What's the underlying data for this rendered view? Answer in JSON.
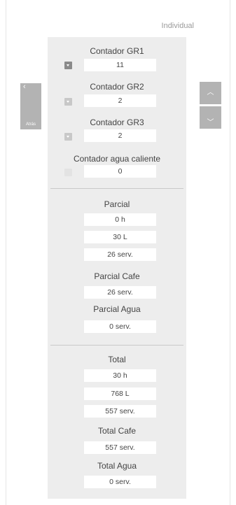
{
  "header": {
    "mode": "Individual"
  },
  "nav": {
    "back_label": "Atrás",
    "back_chevron": "‹",
    "up_chevron": "︿",
    "down_chevron": "﹀"
  },
  "counters": [
    {
      "title": "Contador GR1",
      "value": "11"
    },
    {
      "title": "Contador GR2",
      "value": "2"
    },
    {
      "title": "Contador GR3",
      "value": "2"
    },
    {
      "title": "Contador agua caliente",
      "value": "0"
    }
  ],
  "partial": {
    "title": "Parcial",
    "values": [
      "0 h",
      "30 L",
      "26 serv."
    ],
    "cafe_title": "Parcial Cafe",
    "cafe_value": "26 serv.",
    "agua_title": "Parcial Agua",
    "agua_value": "0 serv."
  },
  "total": {
    "title": "Total",
    "values": [
      "30 h",
      "768 L",
      "557 serv."
    ],
    "cafe_title": "Total Cafe",
    "cafe_value": "557 serv.",
    "agua_title": "Total Agua",
    "agua_value": "0 serv."
  }
}
